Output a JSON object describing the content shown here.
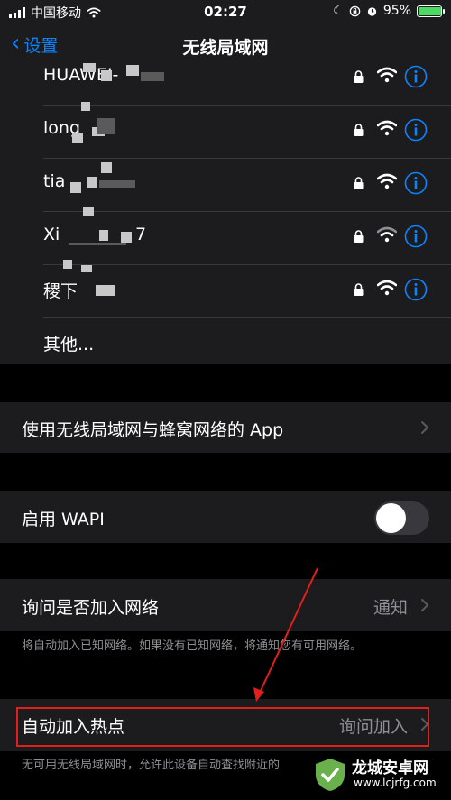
{
  "status_bar": {
    "carrier": "中国移动",
    "time": "02:27",
    "battery_percent": "95%",
    "battery_level": 0.95,
    "icons": [
      "signal-icon",
      "wifi-icon",
      "moon-icon",
      "orientation-lock-icon",
      "alarm-icon",
      "battery-icon"
    ]
  },
  "nav": {
    "back_label": "设置",
    "title": "无线局域网"
  },
  "networks": [
    {
      "name": "HUAWEI-",
      "locked": true,
      "signal": "full"
    },
    {
      "name": "long",
      "locked": true,
      "signal": "full"
    },
    {
      "name": "tia",
      "locked": true,
      "signal": "full"
    },
    {
      "name": "Xi",
      "name_suffix": "7",
      "locked": true,
      "signal": "medium"
    },
    {
      "name": "稷下",
      "locked": true,
      "signal": "full"
    }
  ],
  "other_label": "其他...",
  "apps_row": {
    "label": "使用无线局域网与蜂窝网络的 App"
  },
  "wapi_row": {
    "label": "启用 WAPI",
    "enabled": false
  },
  "ask_join": {
    "label": "询问是否加入网络",
    "value": "通知",
    "footer": "将自动加入已知网络。如果没有已知网络，将通知您有可用网络。"
  },
  "auto_hotspot": {
    "label": "自动加入热点",
    "value": "询问加入",
    "footer": "无可用无线局域网时，允许此设备自动查找附近的"
  },
  "colors": {
    "accent": "#0a84ff",
    "cell_bg": "#1c1c1e",
    "page_bg": "#000000",
    "annotation": "#e0201a"
  },
  "watermark": {
    "text": "龙城安卓网",
    "url": "www.lcjrfg.com"
  }
}
